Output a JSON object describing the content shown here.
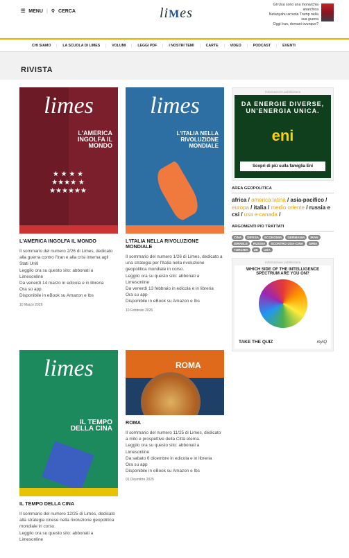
{
  "header": {
    "menu_label": "MENU",
    "search_label": "CERCA",
    "logo_text": "limes",
    "news": [
      "Gli Usa sono una monarchia",
      "anarchica",
      "Netanyahu arruola Trump nella",
      "sua guerra",
      "Oggi Iran, domani ovunque?"
    ]
  },
  "nav": [
    "CHI SIAMO",
    "LA SCUOLA DI LIMES",
    "VOLUMI",
    "LEGGI PDF",
    "I NOSTRI TEMI",
    "CARTE",
    "VIDEO",
    "PODCAST",
    "EVENTI"
  ],
  "page_title": "RIVISTA",
  "cards": [
    {
      "title": "L'AMERICA INGOLFA IL MONDO",
      "cover_title": "L'AMERICA INGOLFA IL MONDO",
      "text": "Il sommario del numero 2/26 di Limes, dedicato alla guerra contro l'Iran e alla crisi interna agli Stati Uniti",
      "text2": "Leggilo ora su questo sito: abbonati a Limesonline",
      "text3": "Da venerdì 14 marzo in edicola e in libreria",
      "text4": "Ora su app",
      "text5": "Disponibile in eBook su Amazon e Ibs",
      "date": "10 Marzo 2026",
      "color": "#7a1f2b"
    },
    {
      "title": "L'ITALIA NELLA RIVOLUZIONE MONDIALE",
      "cover_title": "L'ITALIA NELLA RIVOLUZIONE MONDIALE",
      "text": "Il sommario del numero 1/26 di Limes, dedicato a una strategia per l'Italia nella rivoluzione geopolitica mondiale in corso.",
      "text2": "Leggilo ora su questo sito: abbonati a Limesonline",
      "text3": "Da venerdì 13 febbraio in edicola e in libreria",
      "text4": "Ora su app",
      "text5": "Disponibile in eBook su Amazon e Ibs",
      "date": "10 Febbraio 2026",
      "color": "#2d6fa3"
    },
    {
      "title": "IL TEMPO DELLA CINA",
      "cover_title": "IL TEMPO DELLA CINA",
      "text": "Il sommario del numero 12/25 di Limes, dedicato alla strategia cinese nella rivoluzione geopolitica mondiale in corso.",
      "text2": "Leggilo ora su questo sito: abbonati a Limesonline",
      "text3": "",
      "text4": "",
      "text5": "",
      "date": "",
      "color": "#1d8a5e"
    },
    {
      "title": "ROMA",
      "cover_title": "ROMA",
      "text": "Il sommario del numero 11/25 di Limes, dedicato a mito e prospettive della Città eterna.",
      "text2": "Leggilo ora su questo sito: abbonati a Limesonline",
      "text3": "Da sabato 6 dicembre in edicola e in libreria",
      "text4": "Ora su app",
      "text5": "Disponibile in eBook su Amazon e Ibs",
      "date": "01 Dicembre 2025",
      "color": "#1e3f66"
    }
  ],
  "ad1": {
    "label": "Informazione pubblicitaria",
    "headline": "DA ENERGIE DIVERSE, UN'ENERGIA UNICA.",
    "brand": "eni",
    "button": "Scopri di più sulla famiglia Eni"
  },
  "geo": {
    "title": "AREA GEOPOLITICA"
  },
  "topics": {
    "title": "ARGOMENTI PIÙ TRATTATI",
    "tags": [
      "CINA",
      "DIFESA",
      "ECONOMIA",
      "GERMANIA",
      "IRAN",
      "ISRAELE",
      "RUSSIA",
      "SCONTRO USA-CINA",
      "SIRIA",
      "TURCHIA",
      "UE",
      "USA"
    ]
  },
  "ad2": {
    "label": "Informazione pubblicitaria",
    "question": "WHICH SIDE OF THE INTELLIGENCE SPECTRUM ARE YOU ON?",
    "button": "TAKE THE QUIZ",
    "brand": "myIQ"
  }
}
